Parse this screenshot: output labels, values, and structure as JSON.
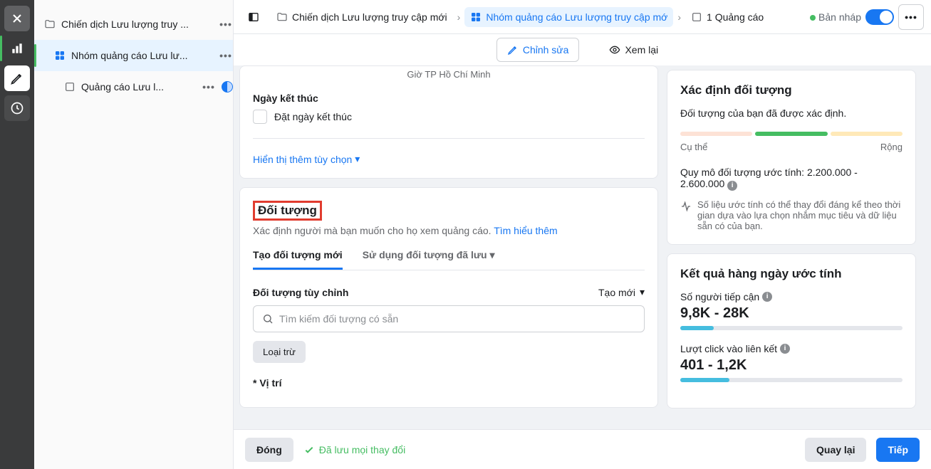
{
  "rail": {},
  "tree": {
    "campaign": "Chiến dịch Lưu lượng truy ...",
    "adset": "Nhóm quảng cáo Lưu lư...",
    "ad": "Quảng cáo Lưu l..."
  },
  "breadcrumb": {
    "campaign": "Chiến dịch Lưu lượng truy cập mới",
    "adset": "Nhóm quảng cáo Lưu lượng truy cập mớ",
    "ad": "1 Quảng cáo",
    "status": "Bản nháp"
  },
  "subbar": {
    "edit": "Chỉnh sửa",
    "review": "Xem lại"
  },
  "schedule": {
    "timezone": "Giờ TP Hồ Chí Minh",
    "end_label": "Ngày kết thúc",
    "set_end": "Đặt ngày kết thúc",
    "show_more": "Hiển thị thêm tùy chọn"
  },
  "audience": {
    "title": "Đối tượng",
    "desc": "Xác định người mà bạn muốn cho họ xem quảng cáo.",
    "learn": "Tìm hiểu thêm",
    "tab_new": "Tạo đối tượng mới",
    "tab_saved": "Sử dụng đối tượng đã lưu",
    "custom_label": "Đối tượng tùy chỉnh",
    "create_new": "Tạo mới",
    "search_placeholder": "Tìm kiếm đối tượng có sẵn",
    "exclude": "Loại trừ",
    "location_label": "* Vị trí"
  },
  "definition": {
    "title": "Xác định đối tượng",
    "desc": "Đối tượng của bạn đã được xác định.",
    "specific": "Cụ thể",
    "broad": "Rộng",
    "size_label": "Quy mô đối tượng ước tính:",
    "size_value": "2.200.000 - 2.600.000",
    "note": "Số liệu ước tính có thể thay đổi đáng kể theo thời gian dựa vào lựa chọn nhắm mục tiêu và dữ liệu sẵn có của bạn."
  },
  "daily": {
    "title": "Kết quả hàng ngày ước tính",
    "reach_label": "Số người tiếp cận",
    "reach_value": "9,8K - 28K",
    "clicks_label": "Lượt click vào liên kết",
    "clicks_value": "401 - 1,2K"
  },
  "footer": {
    "close": "Đóng",
    "saved": "Đã lưu mọi thay đổi",
    "back": "Quay lại",
    "next": "Tiếp"
  }
}
